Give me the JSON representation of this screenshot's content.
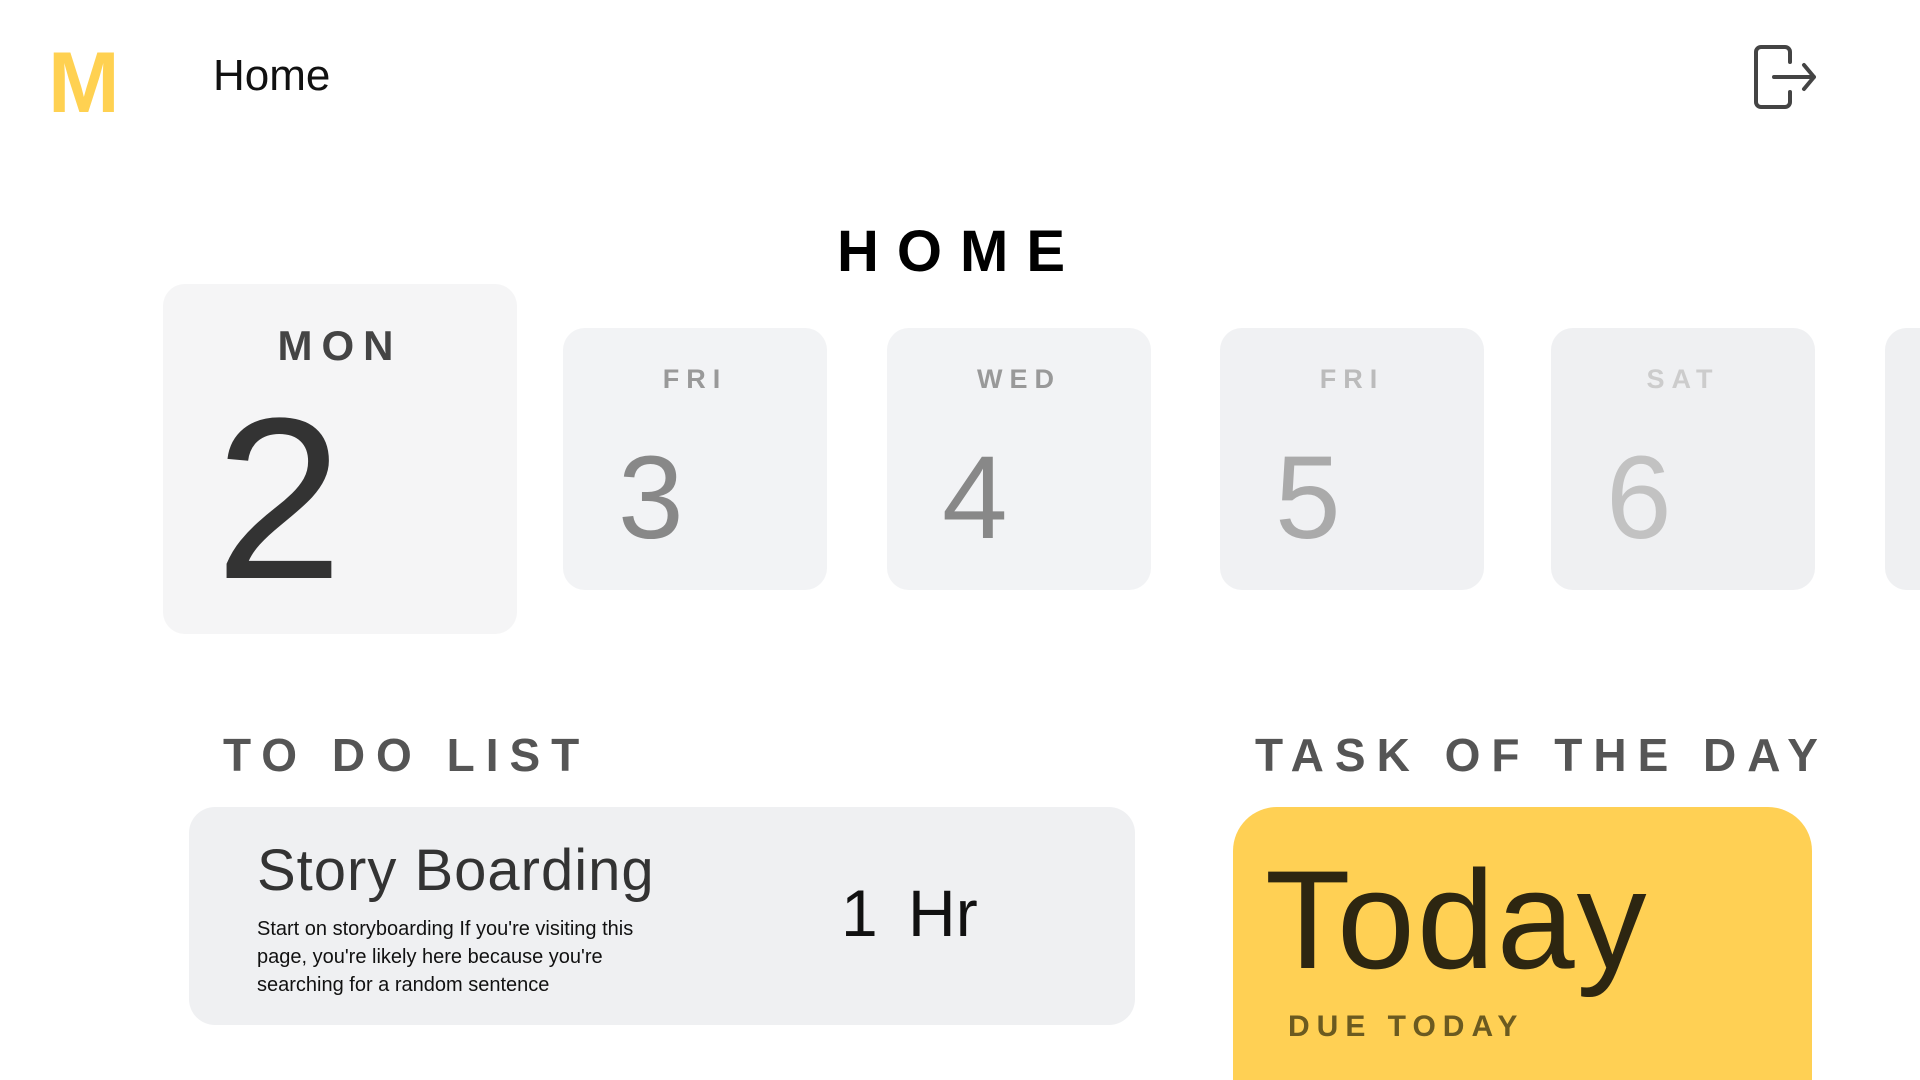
{
  "header": {
    "logo": "M",
    "nav_title": "Home",
    "logout_icon": "logout-icon"
  },
  "page_title": "HOME",
  "calendar": {
    "selected": {
      "day": "MON",
      "date": "2"
    },
    "days": [
      {
        "day": "FRI",
        "date": "3"
      },
      {
        "day": "WED",
        "date": "4"
      },
      {
        "day": "FRI",
        "date": "5"
      },
      {
        "day": "SAT",
        "date": "6"
      }
    ]
  },
  "todo": {
    "heading": "TO DO LIST",
    "items": [
      {
        "title": "Story Boarding",
        "description": "Start on storyboarding If you're visiting this page, you're likely here because you're searching for a random sentence",
        "duration": "1 Hr"
      }
    ]
  },
  "task_of_day": {
    "heading": "TASK OF THE DAY",
    "title": "Today",
    "due": "DUE TODAY"
  },
  "colors": {
    "accent": "#FFD054",
    "logo": "#FFD151"
  }
}
